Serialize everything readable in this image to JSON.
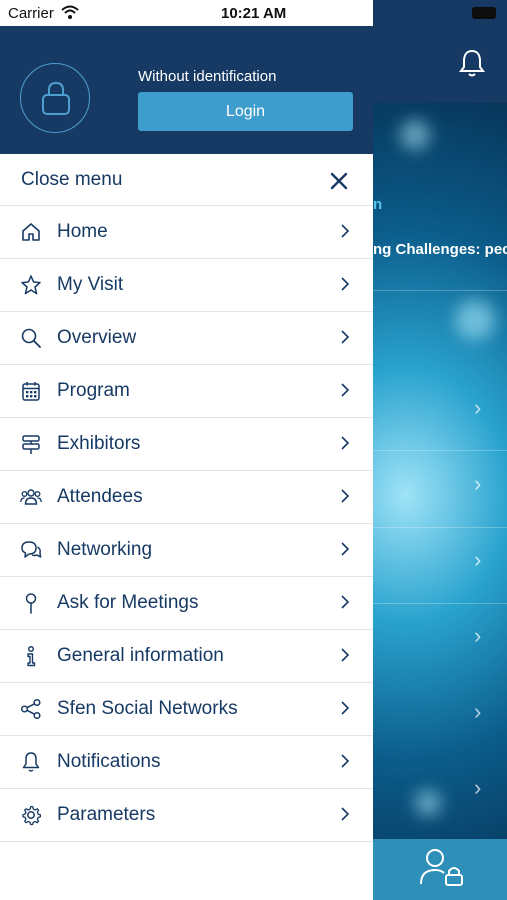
{
  "status_bar": {
    "carrier": "Carrier",
    "time": "10:21 AM"
  },
  "drawer": {
    "identity_label": "Without identification",
    "login_label": "Login",
    "close_label": "Close menu",
    "items": [
      {
        "label": "Home",
        "icon": "home-icon"
      },
      {
        "label": "My Visit",
        "icon": "star-icon"
      },
      {
        "label": "Overview",
        "icon": "search-icon"
      },
      {
        "label": "Program",
        "icon": "calendar-icon"
      },
      {
        "label": "Exhibitors",
        "icon": "signpost-icon"
      },
      {
        "label": "Attendees",
        "icon": "people-icon"
      },
      {
        "label": "Networking",
        "icon": "chat-icon"
      },
      {
        "label": "Ask for Meetings",
        "icon": "pin-icon"
      },
      {
        "label": "General information",
        "icon": "info-icon"
      },
      {
        "label": "Sfen Social Networks",
        "icon": "share-icon"
      },
      {
        "label": "Notifications",
        "icon": "bell-icon"
      },
      {
        "label": "Parameters",
        "icon": "gear-icon"
      }
    ]
  },
  "background": {
    "title_partial_top": "n",
    "title_partial": "ng Challenges: pects"
  },
  "colors": {
    "header": "#173a64",
    "accent": "#3e9dcc",
    "text": "#173a64"
  }
}
